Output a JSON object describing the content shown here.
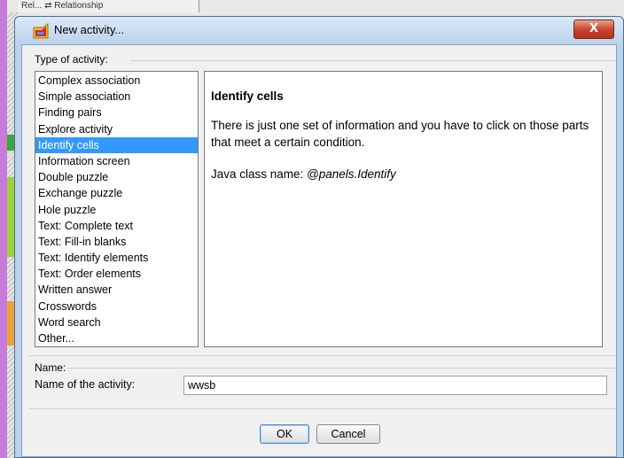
{
  "background": {
    "tab_text": "Rel... ⇄ Relationship"
  },
  "dialog": {
    "title": "New activity...",
    "close_glyph": "X"
  },
  "type_group": {
    "label": "Type of activity:",
    "items": [
      "Complex association",
      "Simple association",
      "Finding pairs",
      "Explore activity",
      "Identify cells",
      "Information screen",
      "Double puzzle",
      "Exchange puzzle",
      "Hole puzzle",
      "Text: Complete text",
      "Text: Fill-in blanks",
      "Text: Identify elements",
      "Text: Order elements",
      "Written answer",
      "Crosswords",
      "Word search",
      "Other..."
    ],
    "selected_index": 4
  },
  "description": {
    "title": "Identify cells",
    "body": "There is just one set of information and you have to click on those parts that meet a certain condition.",
    "class_prefix": "Java class name: ",
    "class_name": "@panels.Identify"
  },
  "name_group": {
    "label": "Name:",
    "field_label": "Name of the activity:",
    "field_value": "wwsb"
  },
  "buttons": {
    "ok": "OK",
    "cancel": "Cancel"
  },
  "colors": {
    "selection": "#3399ff",
    "frame": "#bcd3ee",
    "close": "#c8412a"
  }
}
